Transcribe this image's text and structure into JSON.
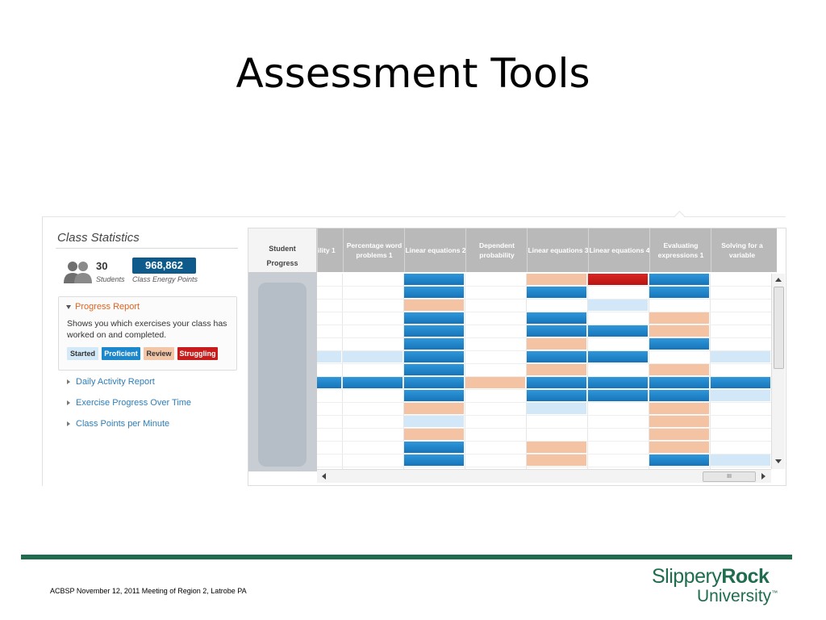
{
  "slide": {
    "title": "Assessment Tools"
  },
  "class_stats": {
    "title": "Class Statistics",
    "students_count": "30",
    "students_label": "Students",
    "energy_points": "968,862",
    "energy_label": "Class Energy Points"
  },
  "progress_report": {
    "heading": "Progress Report",
    "description": "Shows you which exercises your class has worked on and completed.",
    "legend": {
      "started": "Started",
      "proficient": "Proficient",
      "review": "Review",
      "struggling": "Struggling"
    }
  },
  "nav_links": [
    "Daily Activity Report",
    "Exercise Progress Over Time",
    "Class Points per Minute"
  ],
  "grid": {
    "student_header": {
      "line1": "Student",
      "line2": "Progress"
    },
    "columns": [
      "ility 1",
      "Percentage word problems 1",
      "Linear equations 2",
      "Dependent probability",
      "Linear equations 3",
      "Linear equations 4",
      "Evaluating expressions 1",
      "Solving for a variable"
    ],
    "rows": [
      [
        "",
        "",
        "P",
        "",
        "R",
        "S",
        "P",
        ""
      ],
      [
        "",
        "",
        "P",
        "",
        "P",
        "",
        "P",
        ""
      ],
      [
        "",
        "",
        "R",
        "",
        "",
        "T",
        "",
        ""
      ],
      [
        "",
        "",
        "P",
        "",
        "P",
        "",
        "R",
        ""
      ],
      [
        "",
        "",
        "P",
        "",
        "P",
        "P",
        "R",
        ""
      ],
      [
        "",
        "",
        "P",
        "",
        "R",
        "",
        "P",
        ""
      ],
      [
        "T",
        "T",
        "P",
        "",
        "P",
        "P",
        "",
        "T"
      ],
      [
        "",
        "",
        "P",
        "",
        "R",
        "",
        "R",
        ""
      ],
      [
        "P",
        "P",
        "P",
        "R",
        "P",
        "P",
        "P",
        "P"
      ],
      [
        "",
        "",
        "P",
        "",
        "P",
        "P",
        "P",
        "T"
      ],
      [
        "",
        "",
        "R",
        "",
        "T",
        "",
        "R",
        ""
      ],
      [
        "",
        "",
        "T",
        "",
        "",
        "",
        "R",
        ""
      ],
      [
        "",
        "",
        "R",
        "",
        "",
        "",
        "R",
        ""
      ],
      [
        "",
        "",
        "P",
        "",
        "R",
        "",
        "R",
        ""
      ],
      [
        "",
        "",
        "P",
        "",
        "R",
        "",
        "P",
        "T"
      ]
    ],
    "hscroll_thumb_label": "III",
    "colors": {
      "P": "#1d87cc",
      "R": "#f4c3a3",
      "T": "#d2e7f7",
      "S": "#c81b1b"
    }
  },
  "icons": {
    "people": "people-icon",
    "vscroll_up": "arrow-up-icon",
    "vscroll_down": "arrow-down-icon",
    "hscroll_left": "arrow-left-icon",
    "hscroll_right": "arrow-right-icon"
  },
  "footer": {
    "text": "ACBSP November 12, 2011 Meeting of Region 2, Latrobe PA",
    "logo_part1": "Slippery",
    "logo_part2": "Rock",
    "logo_line2": "University",
    "logo_tm": "™",
    "accent": "#1f6d4e"
  }
}
